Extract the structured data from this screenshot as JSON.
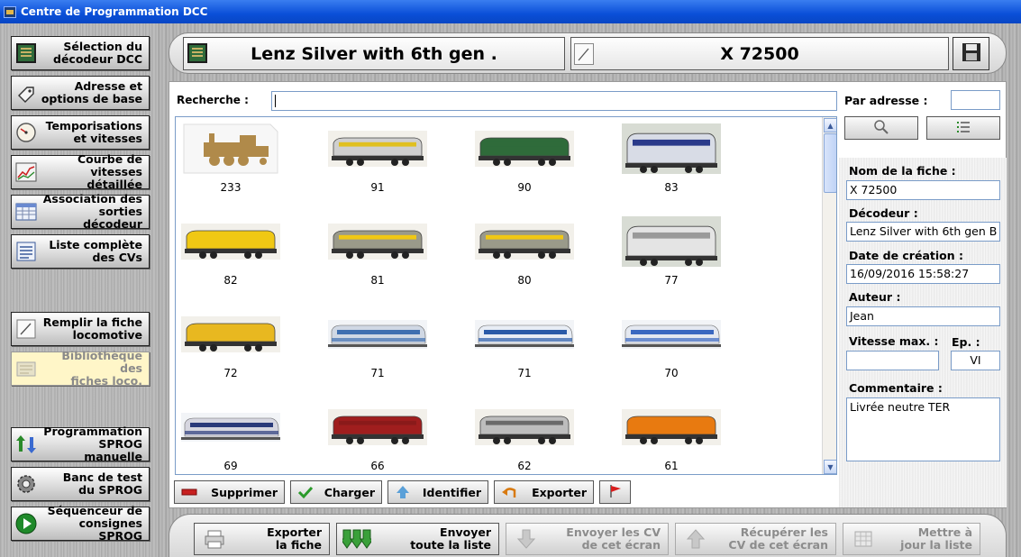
{
  "window": {
    "title": "Centre de Programmation DCC"
  },
  "nav": [
    {
      "label": "Sélection du\ndécodeur DCC",
      "icon": "decoder-chip-icon"
    },
    {
      "label": "Adresse et\noptions de base",
      "icon": "tag-icon"
    },
    {
      "label": "Temporisations\net vitesses",
      "icon": "gauge-icon"
    },
    {
      "label": "Courbe de\nvitesses détaillée",
      "icon": "speed-curve-icon"
    },
    {
      "label": "Association des\nsorties décodeur",
      "icon": "table-grid-icon"
    },
    {
      "label": "Liste complète\ndes CVs",
      "icon": "list-panel-icon"
    },
    {
      "label": "Remplir la fiche\nlocomotive",
      "icon": "pen-icon"
    },
    {
      "label": "Bibliothèque des\nfiches loco.",
      "icon": "library-icon"
    },
    {
      "label": "Programmation\nSPROG manuelle",
      "icon": "program-arrows-icon"
    },
    {
      "label": "Banc de test\ndu SPROG",
      "icon": "gear-icon"
    },
    {
      "label": "Séquenceur de\nconsignes SPROG",
      "icon": "play-icon"
    }
  ],
  "header": {
    "decoder": "Lenz Silver with 6th gen .",
    "sheet": "X 72500"
  },
  "search": {
    "label": "Recherche :",
    "value": ""
  },
  "thumbnails": [
    {
      "caption": "233",
      "kind": "steam",
      "color": "#b08a4a"
    },
    {
      "caption": "91",
      "kind": "loco",
      "color": "#e0c020",
      "body": "#cfcfcf"
    },
    {
      "caption": "90",
      "kind": "loco",
      "color": "#2f6b3a",
      "body": "#2f6b3a"
    },
    {
      "caption": "83",
      "kind": "bigloco",
      "color": "#2a3a8a",
      "body": "#d8dce6"
    },
    {
      "caption": "82",
      "kind": "loco",
      "color": "#f0c814",
      "body": "#f0c814"
    },
    {
      "caption": "81",
      "kind": "loco",
      "color": "#f0c814",
      "body": "#9a9a8a"
    },
    {
      "caption": "80",
      "kind": "loco",
      "color": "#f0c814",
      "body": "#9a9a8a"
    },
    {
      "caption": "77",
      "kind": "bigloco",
      "color": "#9a9a9a",
      "body": "#e4e4e4"
    },
    {
      "caption": "72",
      "kind": "loco",
      "color": "#e8b820",
      "body": "#e8b820"
    },
    {
      "caption": "71",
      "kind": "train",
      "color": "#3f6fb0",
      "body": "#d0d8e4"
    },
    {
      "caption": "71",
      "kind": "train",
      "color": "#2a5aa8",
      "body": "#e8edf5"
    },
    {
      "caption": "70",
      "kind": "train",
      "color": "#3a68c0",
      "body": "#e4e8f0"
    },
    {
      "caption": "69",
      "kind": "train",
      "color": "#2a3a7a",
      "body": "#d6d6e0"
    },
    {
      "caption": "66",
      "kind": "loco",
      "color": "#8a1a1a",
      "body": "#a01e1e"
    },
    {
      "caption": "62",
      "kind": "loco",
      "color": "#6a6a6a",
      "body": "#bdbdbd"
    },
    {
      "caption": "61",
      "kind": "loco",
      "color": "#e87a10",
      "body": "#e87a10"
    }
  ],
  "actions": {
    "delete": "Supprimer",
    "load": "Charger",
    "identify": "Identifier",
    "export": "Exporter"
  },
  "right": {
    "address_label": "Par adresse :",
    "address_value": "",
    "name_label": "Nom de la fiche :",
    "name_value": "X 72500",
    "decoder_label": "Décodeur :",
    "decoder_value": "Lenz Silver with 6th gen B",
    "date_label": "Date de création :",
    "date_value": "16/09/2016 15:58:27",
    "author_label": "Auteur :",
    "author_value": "Jean",
    "speed_label": "Vitesse max. :",
    "speed_value": "",
    "era_label": "Ep. :",
    "era_value": "VI",
    "comment_label": "Commentaire :",
    "comment_value": "Livrée neutre TER"
  },
  "footer": {
    "export_sheet": "Exporter\nla fiche",
    "send_list": "Envoyer\ntoute la liste",
    "send_cv": "Envoyer les CV\nde cet écran",
    "get_cv": "Récupérer les\nCV de cet écran",
    "update_list": "Mettre à\njour la liste"
  }
}
